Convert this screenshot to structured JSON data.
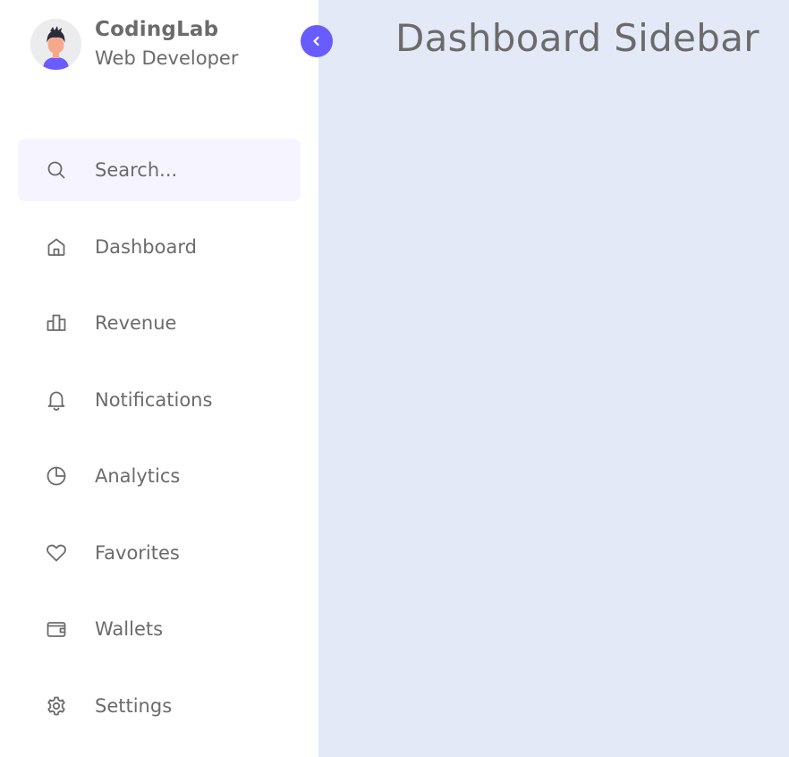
{
  "profile": {
    "name": "CodingLab",
    "role": "Web Developer",
    "avatar_icon": "user-avatar-icon"
  },
  "toggle": {
    "icon": "chevron-left-icon",
    "color": "#695cfe"
  },
  "search": {
    "placeholder": "Search...",
    "value": ""
  },
  "nav": {
    "items": [
      {
        "label": "Dashboard",
        "icon": "home-icon"
      },
      {
        "label": "Revenue",
        "icon": "bar-chart-icon"
      },
      {
        "label": "Notifications",
        "icon": "bell-icon"
      },
      {
        "label": "Analytics",
        "icon": "pie-chart-icon"
      },
      {
        "label": "Favorites",
        "icon": "heart-icon"
      },
      {
        "label": "Wallets",
        "icon": "wallet-icon"
      },
      {
        "label": "Settings",
        "icon": "gear-icon"
      }
    ]
  },
  "main": {
    "title": "Dashboard Sidebar"
  },
  "colors": {
    "sidebar_bg": "#ffffff",
    "main_bg": "#e4e9f7",
    "accent": "#695cfe",
    "text": "#6b6b6b",
    "search_bg": "#f6f5ff"
  }
}
